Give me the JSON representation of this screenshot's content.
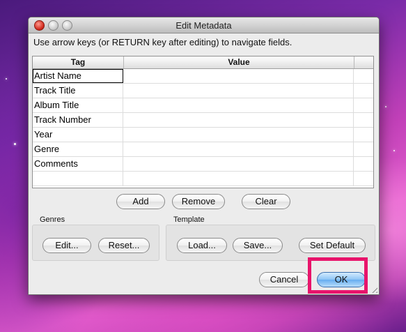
{
  "window": {
    "title": "Edit Metadata",
    "instruction": "Use arrow keys (or RETURN key after editing) to navigate fields."
  },
  "table": {
    "headers": {
      "tag": "Tag",
      "value": "Value"
    },
    "rows": [
      {
        "tag": "Artist Name",
        "value": ""
      },
      {
        "tag": "Track Title",
        "value": ""
      },
      {
        "tag": "Album Title",
        "value": ""
      },
      {
        "tag": "Track Number",
        "value": ""
      },
      {
        "tag": "Year",
        "value": ""
      },
      {
        "tag": "Genre",
        "value": ""
      },
      {
        "tag": "Comments",
        "value": ""
      },
      {
        "tag": "",
        "value": ""
      }
    ]
  },
  "row_buttons": {
    "add": "Add",
    "remove": "Remove",
    "clear": "Clear"
  },
  "genres": {
    "label": "Genres",
    "edit": "Edit...",
    "reset": "Reset..."
  },
  "template": {
    "label": "Template",
    "load": "Load...",
    "save": "Save...",
    "set_default": "Set Default"
  },
  "footer": {
    "cancel": "Cancel",
    "ok": "OK"
  },
  "colors": {
    "highlight": "#e8146b",
    "default_button": "#8cc4f5"
  }
}
